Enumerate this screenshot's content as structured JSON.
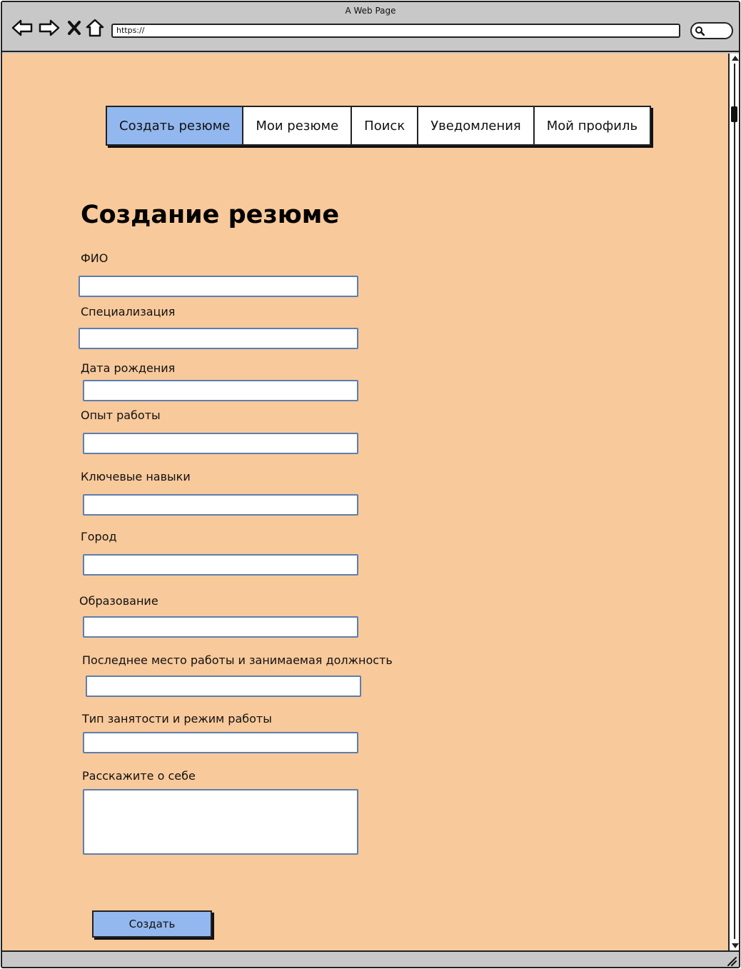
{
  "browser": {
    "window_title": "A Web Page",
    "url": "https://",
    "icons": [
      "back-icon",
      "forward-icon",
      "close-icon",
      "home-icon",
      "search-icon"
    ]
  },
  "nav": {
    "tabs": [
      {
        "label": "Создать резюме",
        "active": true
      },
      {
        "label": "Мои резюме",
        "active": false
      },
      {
        "label": "Поиск",
        "active": false
      },
      {
        "label": "Уведомления",
        "active": false
      },
      {
        "label": "Мой профиль",
        "active": false
      }
    ]
  },
  "form": {
    "title": "Создание резюме",
    "fields": [
      {
        "label": "ФИО",
        "value": ""
      },
      {
        "label": "Специализация",
        "value": ""
      },
      {
        "label": "Дата рождения",
        "value": ""
      },
      {
        "label": "Опыт работы",
        "value": ""
      },
      {
        "label": "Ключевые навыки",
        "value": ""
      },
      {
        "label": "Город",
        "value": ""
      },
      {
        "label": "Образование",
        "value": ""
      },
      {
        "label": "Последнее место работы и занимаемая должность",
        "value": ""
      },
      {
        "label": "Тип занятости и режим работы",
        "value": ""
      },
      {
        "label": "Расскажите о себе",
        "value": ""
      }
    ],
    "submit_label": "Создать"
  },
  "colors": {
    "page_background": "#f8c99b",
    "accent": "#93b8ef",
    "input_border": "#5d7eae",
    "chrome": "#c8c8c8"
  }
}
